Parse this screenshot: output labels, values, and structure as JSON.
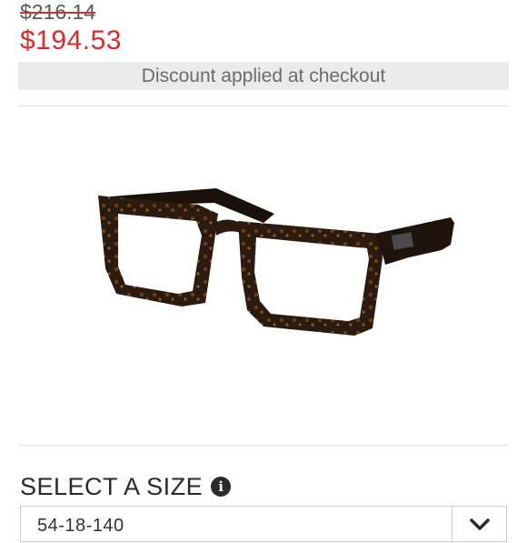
{
  "pricing": {
    "original_price": "$216.14",
    "sale_price": "$194.53",
    "discount_note": "Discount applied at checkout"
  },
  "product": {
    "image_icon": "eyeglasses-icon",
    "frame_color": "#2b1a10",
    "tortoise_accent": "#8a5a1c"
  },
  "size_selector": {
    "heading": "SELECT A SIZE",
    "info_icon": "info-icon",
    "info_glyph": "i",
    "selected_value": "54-18-140",
    "dropdown_icon": "chevron-down-icon"
  },
  "colors": {
    "sale_red": "#d82c2c",
    "discount_bar_bg": "#ebebeb",
    "strike_red": "#d32f2f"
  }
}
